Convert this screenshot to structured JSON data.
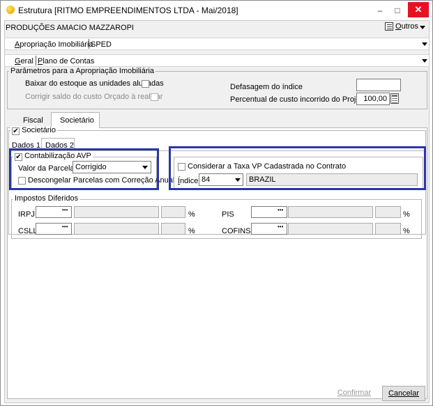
{
  "window": {
    "title": "Estrutura [RITMO EMPREENDIMENTOS LTDA - Mai/2018]",
    "min_symbol": "–",
    "max_symbol": "□",
    "close_symbol": "✕"
  },
  "header": {
    "company": "PRODUÇÕES AMACIO MAZZAROPI",
    "outros_label": "Outros"
  },
  "top_tabs": {
    "tab1": "Apropriação Imobiliária",
    "tab2": "SPED"
  },
  "sub_tabs": {
    "tab1": "Geral",
    "tab2": "Plano de Contas"
  },
  "params": {
    "legend": "Parâmetros para a Apropriação Imobiliária",
    "baixar_label": "Baixar do estoque as unidades alugadas",
    "corrigir_label": "Corrigir saldo do custo Orçado à realizar",
    "defasagem_label": "Defasagem do índice",
    "defasagem_value": "",
    "percentual_label": "Percentual de custo incorrido do Projeto",
    "percentual_value": "100,00"
  },
  "mid_tabs": {
    "fiscal": "Fiscal",
    "societario": "Societário"
  },
  "societario": {
    "legend": "Societário",
    "checked": true,
    "tab_dados1": "Dados 1",
    "tab_dados2": "Dados 2"
  },
  "avp": {
    "legend": "Contabilização AVP",
    "checked": true,
    "valor_label": "Valor da Parcela",
    "valor_value": "Corrigido",
    "descongelar_label": "Descongelar Parcelas com Correção Anual",
    "descongelar_checked": false
  },
  "taxa": {
    "considerar_label": "Considerar a Taxa VP Cadastrada no Contrato",
    "considerar_checked": false,
    "indice_label": "Índice",
    "indice_value": "84",
    "indice_name": "BRAZIL"
  },
  "impostos": {
    "legend": "Impostos Diferidos",
    "irpj_label": "IRPJ",
    "csll_label": "CSLL",
    "pis_label": "PIS",
    "cofins_label": "COFINS",
    "ellipsis": "•••",
    "percent": "%"
  },
  "footer": {
    "confirmar": "Confirmar",
    "cancelar": "Cancelar"
  },
  "colors": {
    "highlight_border": "#2b35a8",
    "close_red": "#e81123",
    "title_icon": "#f2b200"
  }
}
